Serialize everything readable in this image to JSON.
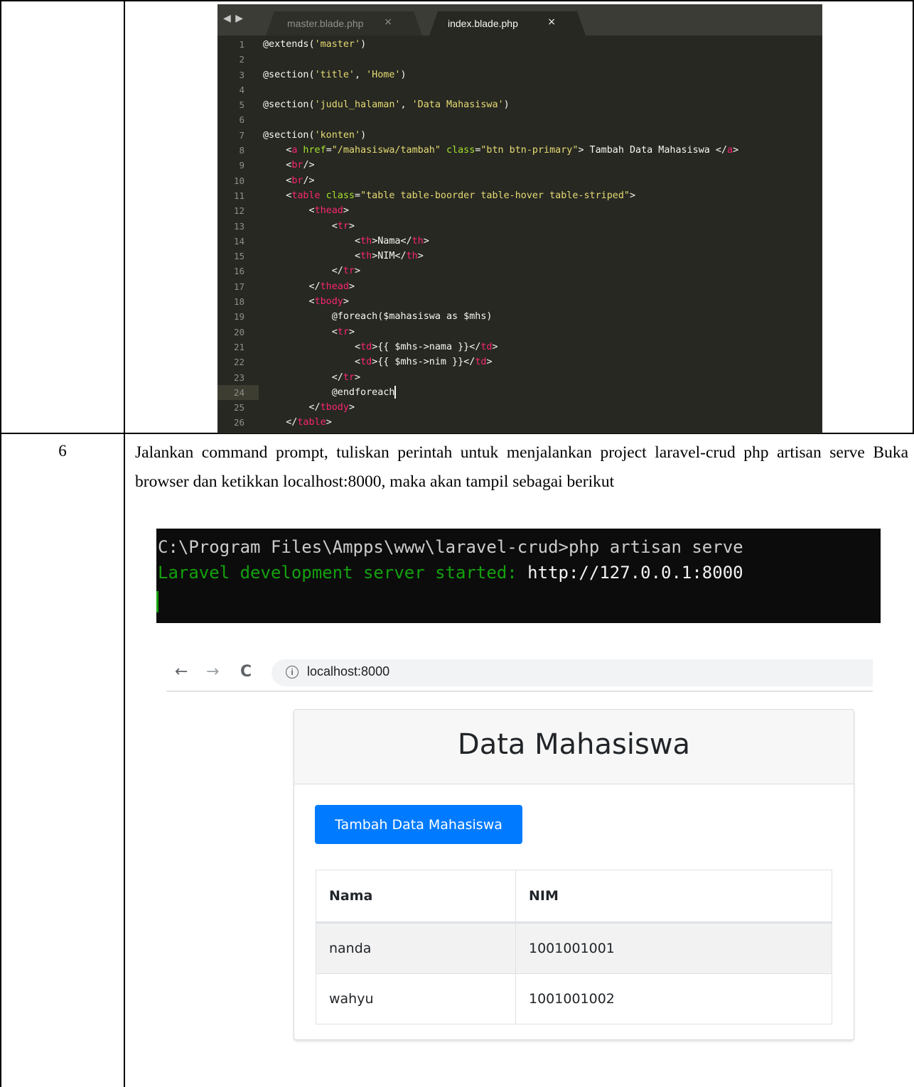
{
  "editor": {
    "tabs": [
      {
        "label": "master.blade.php",
        "close": "×"
      },
      {
        "label": "index.blade.php",
        "close": "×"
      }
    ],
    "nav_arrows": "◀ ▶",
    "lines": [
      {
        "n": "1",
        "parts": [
          [
            "t-txt",
            "@extends("
          ],
          [
            "t-str",
            "'master'"
          ],
          [
            "t-txt",
            ")"
          ]
        ]
      },
      {
        "n": "2",
        "parts": []
      },
      {
        "n": "3",
        "parts": [
          [
            "t-txt",
            "@section("
          ],
          [
            "t-str",
            "'title'"
          ],
          [
            "t-txt",
            ", "
          ],
          [
            "t-str",
            "'Home'"
          ],
          [
            "t-txt",
            ")"
          ]
        ]
      },
      {
        "n": "4",
        "parts": []
      },
      {
        "n": "5",
        "parts": [
          [
            "t-txt",
            "@section("
          ],
          [
            "t-str",
            "'judul_halaman'"
          ],
          [
            "t-txt",
            ", "
          ],
          [
            "t-str",
            "'Data Mahasiswa'"
          ],
          [
            "t-txt",
            ")"
          ]
        ]
      },
      {
        "n": "6",
        "parts": []
      },
      {
        "n": "7",
        "parts": [
          [
            "t-txt",
            "@section("
          ],
          [
            "t-str",
            "'konten'"
          ],
          [
            "t-txt",
            ")"
          ]
        ]
      },
      {
        "n": "8",
        "parts": [
          [
            "t-txt",
            "    <"
          ],
          [
            "t-tag",
            "a"
          ],
          [
            "t-attr",
            " href"
          ],
          [
            "t-txt",
            "="
          ],
          [
            "t-str",
            "\"/mahasiswa/tambah\""
          ],
          [
            "t-attr",
            " class"
          ],
          [
            "t-txt",
            "="
          ],
          [
            "t-str",
            "\"btn btn-primary\""
          ],
          [
            "t-txt",
            "> Tambah Data Mahasiswa </"
          ],
          [
            "t-tag",
            "a"
          ],
          [
            "t-txt",
            ">"
          ]
        ]
      },
      {
        "n": "9",
        "parts": [
          [
            "t-txt",
            "    <"
          ],
          [
            "t-tag",
            "br"
          ],
          [
            "t-txt",
            "/>"
          ]
        ]
      },
      {
        "n": "10",
        "parts": [
          [
            "t-txt",
            "    <"
          ],
          [
            "t-tag",
            "br"
          ],
          [
            "t-txt",
            "/>"
          ]
        ]
      },
      {
        "n": "11",
        "parts": [
          [
            "t-txt",
            "    <"
          ],
          [
            "t-tag",
            "table"
          ],
          [
            "t-attr",
            " class"
          ],
          [
            "t-txt",
            "="
          ],
          [
            "t-str",
            "\"table table-boorder table-hover table-striped\""
          ],
          [
            "t-txt",
            ">"
          ]
        ]
      },
      {
        "n": "12",
        "parts": [
          [
            "t-txt",
            "        <"
          ],
          [
            "t-tag",
            "thead"
          ],
          [
            "t-txt",
            ">"
          ]
        ]
      },
      {
        "n": "13",
        "parts": [
          [
            "t-txt",
            "            <"
          ],
          [
            "t-tag",
            "tr"
          ],
          [
            "t-txt",
            ">"
          ]
        ]
      },
      {
        "n": "14",
        "parts": [
          [
            "t-txt",
            "                <"
          ],
          [
            "t-tag",
            "th"
          ],
          [
            "t-txt",
            ">Nama</"
          ],
          [
            "t-tag",
            "th"
          ],
          [
            "t-txt",
            ">"
          ]
        ]
      },
      {
        "n": "15",
        "parts": [
          [
            "t-txt",
            "                <"
          ],
          [
            "t-tag",
            "th"
          ],
          [
            "t-txt",
            ">NIM</"
          ],
          [
            "t-tag",
            "th"
          ],
          [
            "t-txt",
            ">"
          ]
        ]
      },
      {
        "n": "16",
        "parts": [
          [
            "t-txt",
            "            </"
          ],
          [
            "t-tag",
            "tr"
          ],
          [
            "t-txt",
            ">"
          ]
        ]
      },
      {
        "n": "17",
        "parts": [
          [
            "t-txt",
            "        </"
          ],
          [
            "t-tag",
            "thead"
          ],
          [
            "t-txt",
            ">"
          ]
        ]
      },
      {
        "n": "18",
        "parts": [
          [
            "t-txt",
            "        <"
          ],
          [
            "t-tag",
            "tbody"
          ],
          [
            "t-txt",
            ">"
          ]
        ]
      },
      {
        "n": "19",
        "parts": [
          [
            "t-txt",
            "            @foreach($mahasiswa as $mhs)"
          ]
        ]
      },
      {
        "n": "20",
        "parts": [
          [
            "t-txt",
            "            <"
          ],
          [
            "t-tag",
            "tr"
          ],
          [
            "t-txt",
            ">"
          ]
        ]
      },
      {
        "n": "21",
        "parts": [
          [
            "t-txt",
            "                <"
          ],
          [
            "t-tag",
            "td"
          ],
          [
            "t-txt",
            ">{{ $mhs->nama }}</"
          ],
          [
            "t-tag",
            "td"
          ],
          [
            "t-txt",
            ">"
          ]
        ]
      },
      {
        "n": "22",
        "parts": [
          [
            "t-txt",
            "                <"
          ],
          [
            "t-tag",
            "td"
          ],
          [
            "t-txt",
            ">{{ $mhs->nim }}</"
          ],
          [
            "t-tag",
            "td"
          ],
          [
            "t-txt",
            ">"
          ]
        ]
      },
      {
        "n": "23",
        "parts": [
          [
            "t-txt",
            "            </"
          ],
          [
            "t-tag",
            "tr"
          ],
          [
            "t-txt",
            ">"
          ]
        ]
      },
      {
        "n": "24",
        "parts": [
          [
            "t-txt",
            "            @endforeach"
          ]
        ],
        "current": true
      },
      {
        "n": "25",
        "parts": [
          [
            "t-txt",
            "        </"
          ],
          [
            "t-tag",
            "tbody"
          ],
          [
            "t-txt",
            ">"
          ]
        ]
      },
      {
        "n": "26",
        "parts": [
          [
            "t-txt",
            "    </"
          ],
          [
            "t-tag",
            "table"
          ],
          [
            "t-txt",
            ">"
          ]
        ]
      }
    ]
  },
  "step": {
    "number": "6",
    "text": "Jalankan command prompt, tuliskan perintah untuk menjalankan project laravel-crud php artisan serve Buka browser dan ketikkan localhost:8000, maka akan tampil sebagai berikut"
  },
  "terminal": {
    "line1": "C:\\Program Files\\Ampps\\www\\laravel-crud>php artisan serve",
    "line2_green": "Laravel development server started: ",
    "line2_url": "http://127.0.0.1:8000"
  },
  "browser": {
    "back": "←",
    "forward": "→",
    "reload": "C",
    "info": "i",
    "url": "localhost:8000"
  },
  "page": {
    "title": "Data Mahasiswa",
    "add_button": "Tambah Data Mahasiswa",
    "columns": [
      "Nama",
      "NIM"
    ],
    "rows": [
      [
        "nanda",
        "1001001001"
      ],
      [
        "wahyu",
        "1001001002"
      ]
    ]
  }
}
